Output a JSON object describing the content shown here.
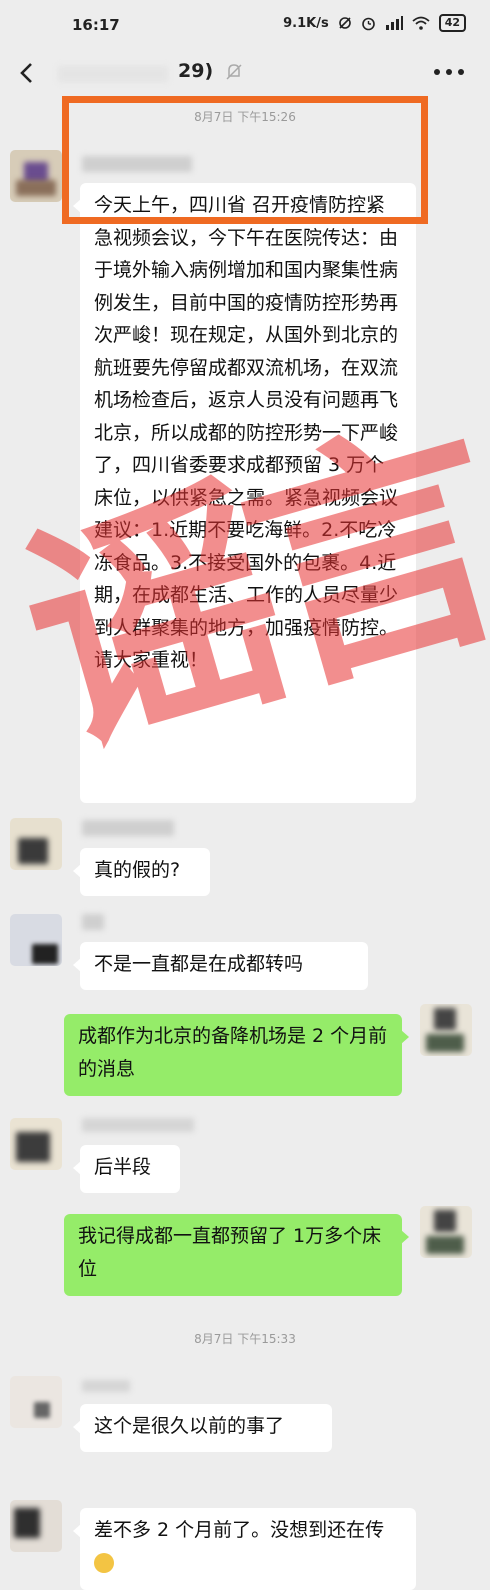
{
  "status_bar": {
    "time": "16:17",
    "speed": "9.1K/s",
    "battery": "42"
  },
  "nav": {
    "title": "29)"
  },
  "timestamps": {
    "first": "8月7日 下午15:26",
    "second": "8月7日 下午15:33"
  },
  "messages": {
    "m1": "今天上午，四川省 召开疫情防控紧急视频会议，今下午在医院传达：由于境外输入病例增加和国内聚集性病例发生，目前中国的疫情防控形势再次严峻！现在规定，从国外到北京的航班要先停留成都双流机场，在双流机场检查后，返京人员没有问题再飞北京，所以成都的防控形势一下严峻了，四川省委要求成都预留 3 万个床位，以供紧急之需。紧急视频会议建议：1.近期不要吃海鲜。2.不吃冷冻食品。3.不接受国外的包裹。4.近期，在成都生活、工作的人员尽量少到人群聚集的地方，加强疫情防控。请大家重视！",
    "m2": "真的假的?",
    "m3": "不是一直都是在成都转吗",
    "m4": "成都作为北京的备降机场是 2 个月前的消息",
    "m5": "后半段",
    "m6": "我记得成都一直都预留了 1万多个床位",
    "m7": "这个是很久以前的事了",
    "m8": "差不多 2 个月前了。没想到还在传"
  },
  "watermark": {
    "text": "谣言"
  },
  "colors": {
    "background": "#ededed",
    "bubble_received": "#ffffff",
    "bubble_sent": "#95ec69",
    "highlight": "#ef6a22",
    "watermark": "#e83232"
  },
  "icons": [
    "back-arrow-icon",
    "mute-bell-icon",
    "more-icon",
    "wifi-icon",
    "alarm-icon",
    "signal-icon"
  ]
}
